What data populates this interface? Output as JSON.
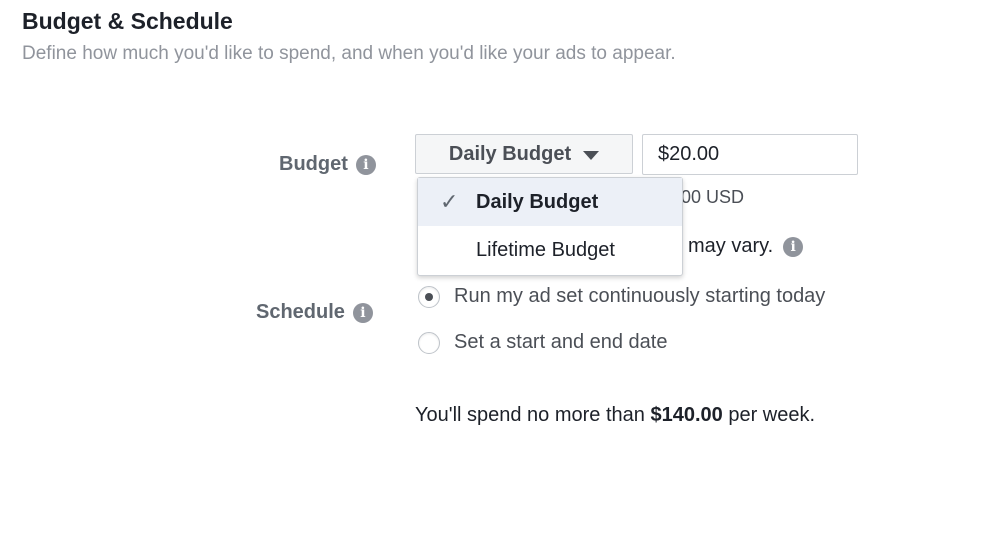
{
  "section": {
    "title": "Budget & Schedule",
    "subtitle": "Define how much you'd like to spend, and when you'd like your ads to appear."
  },
  "budget": {
    "label": "Budget",
    "select_value": "Daily Budget",
    "amount_value": "$20.00",
    "usd_note": ".00 USD",
    "vary_note": "may vary.",
    "dropdown": {
      "items": [
        {
          "label": "Daily Budget",
          "selected": true
        },
        {
          "label": "Lifetime Budget",
          "selected": false
        }
      ]
    }
  },
  "schedule": {
    "label": "Schedule",
    "options": [
      {
        "label": "Run my ad set continuously starting today",
        "checked": true
      },
      {
        "label": "Set a start and end date",
        "checked": false
      }
    ]
  },
  "summary": {
    "prefix": "You'll spend no more than",
    "amount": "$140.00",
    "suffix": "per week."
  },
  "icons": {
    "info": "info-icon",
    "caret": "caret-down-icon",
    "check": "checkmark-icon"
  },
  "colors": {
    "text": "#1d2129",
    "muted": "#90949c",
    "label": "#606770",
    "selected_bg": "#ecf0f7",
    "border": "#ccd0d5"
  }
}
